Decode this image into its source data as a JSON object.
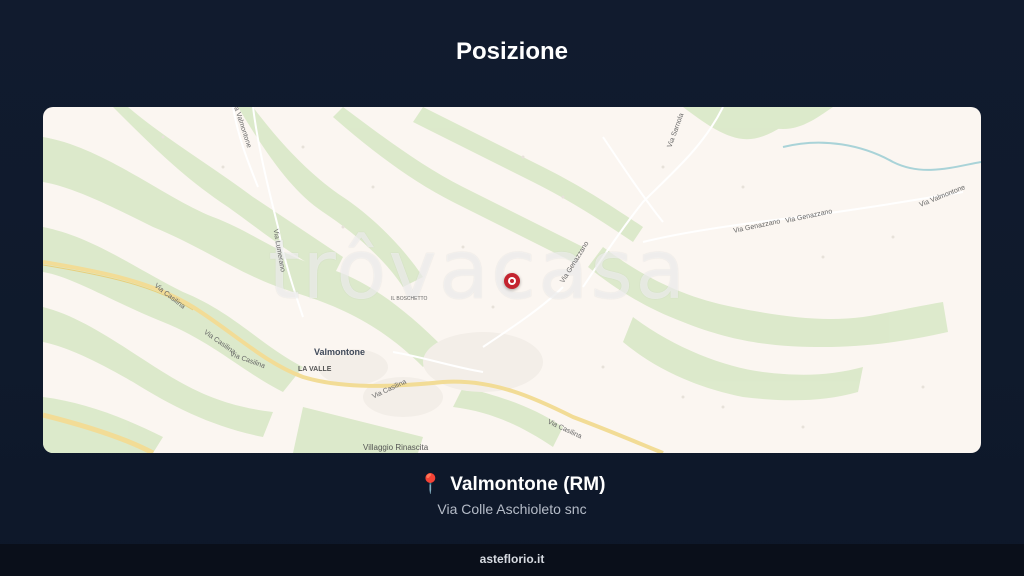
{
  "header": {
    "title": "Posizione"
  },
  "map": {
    "watermark": "trôvacasa",
    "labels": {
      "valmontone": "Valmontone",
      "la_valle": "LA VALLE",
      "villaggio": "Villaggio Rinascita",
      "il_boschetto": "IL BOSCHETTO",
      "via_casilina_1": "Via Casilina",
      "via_casilina_2": "Via Casilina",
      "via_casilina_3": "Via Casilina",
      "via_casilina_4": "Via Casilina",
      "via_casilina_5": "Via Casilina",
      "via_genazzano_1": "Via Genazzano",
      "via_genazzano_2": "Via Genazzano",
      "via_genazzano_3": "Via Genazzano",
      "via_valmontone": "Via Valmontone",
      "via_top_left": "Via Valmontone",
      "via_vertical": "Via Lumerano",
      "via_top_right": "Via Sarnola"
    }
  },
  "location": {
    "icon": "📍",
    "city": "Valmontone (RM)",
    "address": "Via Colle Aschioleto snc"
  },
  "footer": {
    "site": "asteflorio.it"
  },
  "colors": {
    "background": "#111b2e",
    "pin": "#c4242f",
    "map_green": "#d6e8c4"
  }
}
